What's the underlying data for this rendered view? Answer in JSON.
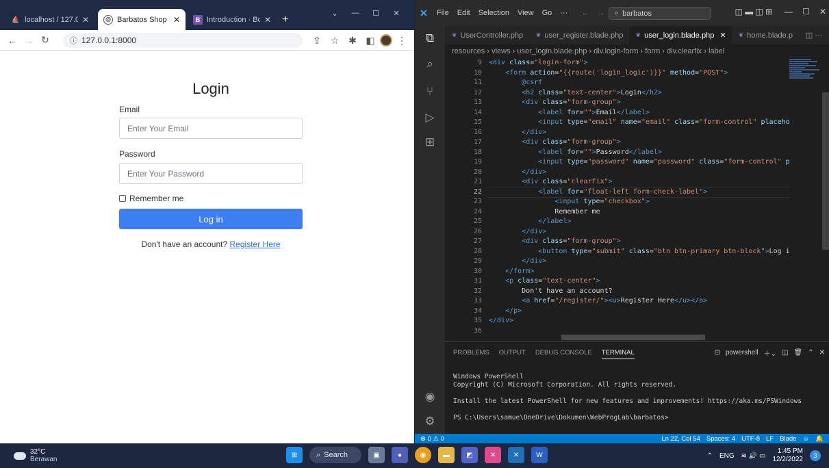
{
  "browser": {
    "tabs": [
      {
        "label": "localhost / 127.0.0",
        "close": "✕",
        "favicon": "phpmyadmin-icon",
        "color": "#f0a030"
      },
      {
        "label": "Barbatos Shop",
        "close": "✕",
        "favicon": "globe-icon",
        "color": "#555555"
      },
      {
        "label": "Introduction · Boo",
        "close": "✕",
        "favicon": "bootstrap-icon",
        "color": "#7952b3"
      }
    ],
    "new_tab": "+",
    "url": "127.0.0.1:8000"
  },
  "login": {
    "title": "Login",
    "email_label": "Email",
    "email_placeholder": "Enter Your Email",
    "password_label": "Password",
    "password_placeholder": "Enter Your Password",
    "remember": "Remember me",
    "button": "Log in",
    "no_account": "Don't have an account?",
    "register_link": "Register Here",
    "accent": "#3d7ef0"
  },
  "vscode": {
    "menu": [
      "File",
      "Edit",
      "Selection",
      "View",
      "Go",
      "···"
    ],
    "command_center": "barbatos",
    "editor_tabs": [
      "UserController.php",
      "user_register.blade.php",
      "user_login.blade.php",
      "home.blade.p"
    ],
    "breadcrumb": "resources › views › user_login.blade.php › div.login-form › form › div.clearfix › label",
    "line_numbers": [
      "9",
      "10",
      "11",
      "12",
      "13",
      "14",
      "15",
      "16",
      "17",
      "18",
      "19",
      "20",
      "21",
      "22",
      "23",
      "24",
      "25",
      "26",
      "27",
      "28",
      "29",
      "30",
      "31",
      "32",
      "33",
      "34",
      "35",
      "36"
    ],
    "panel_tabs": [
      "PROBLEMS",
      "OUTPUT",
      "DEBUG CONSOLE",
      "TERMINAL"
    ],
    "terminal_shell": "powershell",
    "terminal_lines": [
      "Windows PowerShell",
      "Copyright (C) Microsoft Corporation. All rights reserved.",
      "",
      "Install the latest PowerShell for new features and improvements! https://aka.ms/PSWindows",
      "",
      "PS C:\\Users\\samue\\OneDrive\\Dokumen\\WebProgLab\\barbatos>"
    ],
    "status_left": "⊗ 0 ⚠ 0",
    "status_right": [
      "Ln 22, Col 54",
      "Spaces: 4",
      "UTF-8",
      "LF",
      "Blade"
    ]
  },
  "taskbar": {
    "temp": "32°C",
    "weather": "Berawan",
    "search": "Search",
    "lang": "ENG",
    "time": "1:45 PM",
    "date": "12/2/2022",
    "notifications": "3"
  }
}
